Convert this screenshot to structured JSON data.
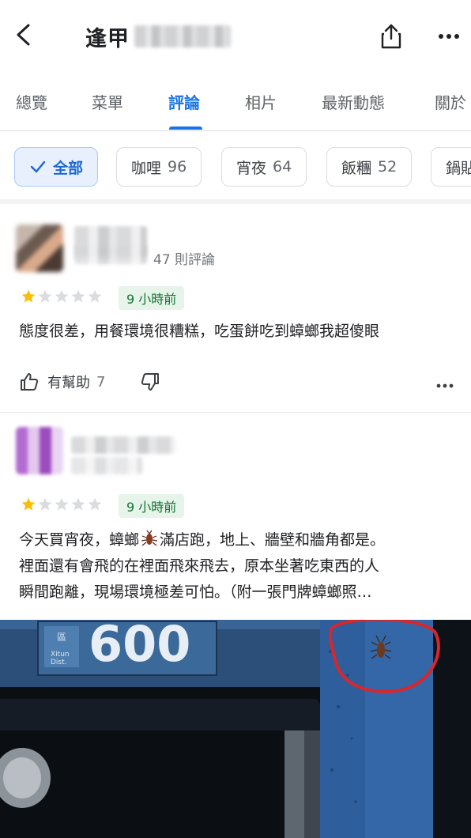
{
  "header": {
    "title": "逢甲"
  },
  "tabs": [
    {
      "label": "總覽"
    },
    {
      "label": "菜單"
    },
    {
      "label": "評論"
    },
    {
      "label": "相片"
    },
    {
      "label": "最新動態"
    },
    {
      "label": "關於"
    }
  ],
  "chips": [
    {
      "label": "全部",
      "count": ""
    },
    {
      "label": "咖哩",
      "count": "96"
    },
    {
      "label": "宵夜",
      "count": "64"
    },
    {
      "label": "飯糰",
      "count": "52"
    },
    {
      "label": "鍋貼",
      "count": ""
    }
  ],
  "reviews": [
    {
      "review_count": "47 則評論",
      "rating": 1,
      "time": "9 小時前",
      "text": "態度很差，用餐環境很糟糕，吃蛋餅吃到蟑螂我超傻眼",
      "helpful_label": "有幫助",
      "helpful_count": "7"
    },
    {
      "rating": 1,
      "time": "9 小時前",
      "text_part1": "今天買宵夜，蟑螂",
      "text_part2": "滿店跑，地上、牆壁和牆角都是。",
      "text_line2": "裡面還有會飛的在裡面飛來飛去，原本坐著吃東西的人",
      "text_line3": "瞬間跑離，現場環境極差可怕。（附一張門牌蟑螂照…",
      "photo_sign_text": "600"
    }
  ],
  "colors": {
    "accent": "#1a73e8",
    "star": "#fbbc04",
    "time_badge_bg": "#e6f4ea",
    "time_badge_text": "#137333"
  }
}
